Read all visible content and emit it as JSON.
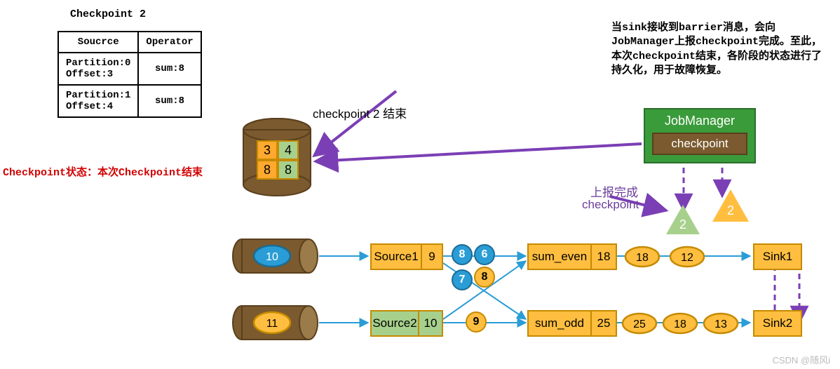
{
  "checkpoint": {
    "title": "Checkpoint 2",
    "columns": {
      "source": "Soucrce",
      "operator": "Operator"
    },
    "rows": [
      {
        "partition": "Partition:0",
        "offset": "Offset:3",
        "sum": "sum:8"
      },
      {
        "partition": "Partition:1",
        "offset": "Offset:4",
        "sum": "sum:8"
      }
    ],
    "status": "Checkpoint状态：本次Checkpoint结束"
  },
  "storage": {
    "label": "checkpoint 2 结束",
    "cells": [
      "3",
      "4",
      "8",
      "8"
    ]
  },
  "explanation": "当sink接收到barrier消息，会向JobManager上报checkpoint完成。至此，本次checkpoint结束，各阶段的状态进行了持久化，用于故障恢复。",
  "jobmanager": {
    "title": "JobManager",
    "button": "checkpoint"
  },
  "report_label_1": "上报完成",
  "report_label_2": "checkpoint",
  "barriers": {
    "green": "2",
    "orange": "2"
  },
  "pipeline": {
    "source_cylinders": {
      "top_value": "10",
      "bottom_value": "11"
    },
    "source1": {
      "name": "Source1",
      "value": "9"
    },
    "source2": {
      "name": "Source2",
      "value": "10"
    },
    "inflight_top": [
      "8",
      "6"
    ],
    "inflight_top_y": "8",
    "inflight_mid": "7",
    "inflight_bottom_y": "9",
    "op_even": {
      "name": "sum_even",
      "value": "18"
    },
    "op_odd": {
      "name": "sum_odd",
      "value": "25"
    },
    "stream_top": [
      "18",
      "12"
    ],
    "stream_bottom": [
      "25",
      "18",
      "13"
    ],
    "sink1": "Sink1",
    "sink2": "Sink2"
  },
  "watermark": "CSDN @随风i"
}
